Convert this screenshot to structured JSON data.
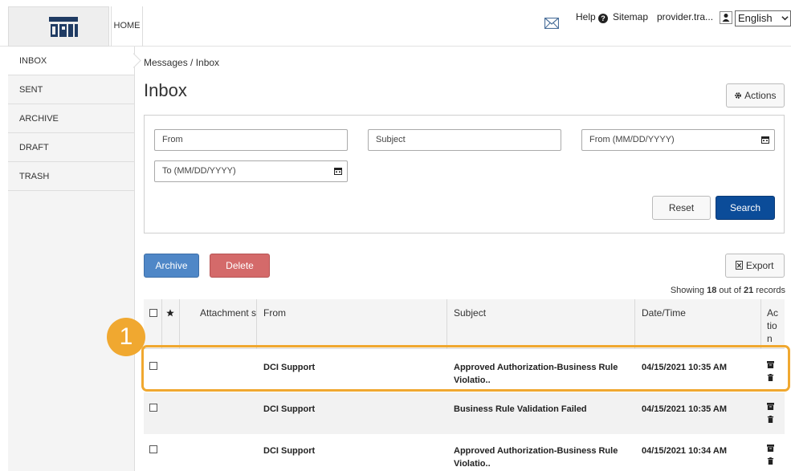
{
  "header": {
    "home_label": "HOME",
    "help_label": "Help",
    "sitemap_label": "Sitemap",
    "user_label": "provider.tra...",
    "language": "English"
  },
  "sidebar": {
    "items": [
      {
        "label": "INBOX",
        "active": true
      },
      {
        "label": "SENT",
        "active": false
      },
      {
        "label": "ARCHIVE",
        "active": false
      },
      {
        "label": "DRAFT",
        "active": false
      },
      {
        "label": "TRASH",
        "active": false
      }
    ]
  },
  "main": {
    "breadcrumb": "Messages / Inbox",
    "title": "Inbox",
    "actions_label": "Actions",
    "filters": {
      "from_placeholder": "From",
      "subject_placeholder": "Subject",
      "from_date_placeholder": "From (MM/DD/YYYY)",
      "to_date_placeholder": "To (MM/DD/YYYY)",
      "reset_label": "Reset",
      "search_label": "Search"
    },
    "archive_label": "Archive",
    "delete_label": "Delete",
    "export_label": "Export",
    "showing_prefix": "Showing",
    "showing_count": "18",
    "showing_mid": "out of",
    "showing_total": "21",
    "showing_suffix": "records"
  },
  "table": {
    "columns": {
      "attachments": "Attachment s",
      "from": "From",
      "subject": "Subject",
      "datetime": "Date/Time",
      "action": "Ac tio n"
    },
    "rows": [
      {
        "from": "DCI Support",
        "subject": "Approved Authorization-Business Rule Violatio..",
        "datetime": "04/15/2021 10:35 AM"
      },
      {
        "from": "DCI Support",
        "subject": "Business Rule Validation Failed",
        "datetime": "04/15/2021 10:35 AM"
      },
      {
        "from": "DCI Support",
        "subject": "Approved Authorization-Business Rule Violatio..",
        "datetime": "04/15/2021 10:34 AM"
      }
    ]
  },
  "annotation": {
    "badge": "1",
    "color": "#f0a830"
  },
  "colors": {
    "search_button": "#0b4c99",
    "archive_button": "#4f87c7",
    "delete_button": "#d46a6a"
  }
}
